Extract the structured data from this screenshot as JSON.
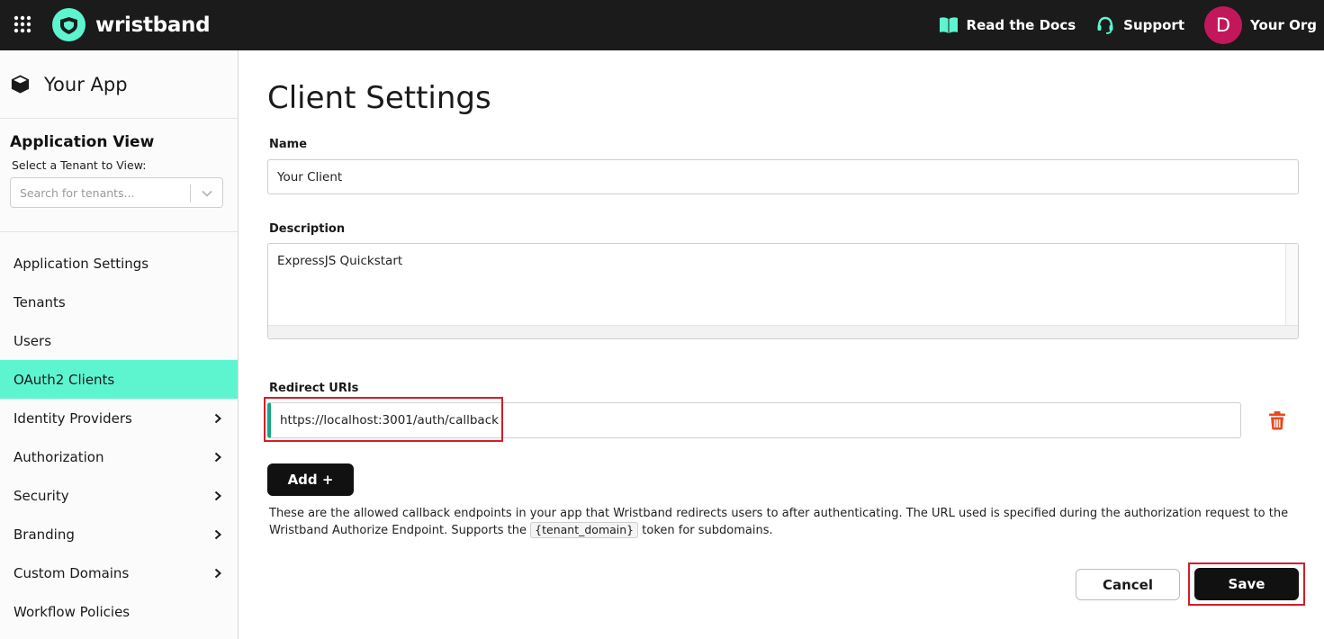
{
  "topbar": {
    "grid_icon": "apps-grid-icon",
    "brand": "wristband",
    "links": [
      {
        "label": "Read the Docs",
        "icon": "book-icon"
      },
      {
        "label": "Support",
        "icon": "headset-icon"
      }
    ],
    "avatar_initial": "D",
    "org_name": "Your Org",
    "colors": {
      "bar": "#1b1b1b",
      "accent": "#5df5d0",
      "avatar": "#c2185b"
    }
  },
  "sidebar": {
    "app_name": "Your App",
    "app_view_title": "Application View",
    "tenant_label": "Select a Tenant to View:",
    "tenant_placeholder": "Search for tenants...",
    "items": [
      {
        "label": "Application Settings",
        "has_submenu": false,
        "active": false
      },
      {
        "label": "Tenants",
        "has_submenu": false,
        "active": false
      },
      {
        "label": "Users",
        "has_submenu": false,
        "active": false
      },
      {
        "label": "OAuth2 Clients",
        "has_submenu": false,
        "active": true
      },
      {
        "label": "Identity Providers",
        "has_submenu": true,
        "active": false
      },
      {
        "label": "Authorization",
        "has_submenu": true,
        "active": false
      },
      {
        "label": "Security",
        "has_submenu": true,
        "active": false
      },
      {
        "label": "Branding",
        "has_submenu": true,
        "active": false
      },
      {
        "label": "Custom Domains",
        "has_submenu": true,
        "active": false
      },
      {
        "label": "Workflow Policies",
        "has_submenu": false,
        "active": false
      }
    ]
  },
  "main": {
    "title": "Client Settings",
    "name_label": "Name",
    "name_value": "Your Client",
    "description_label": "Description",
    "description_value": "ExpressJS Quickstart",
    "redirect_label": "Redirect URIs",
    "redirect_uris": [
      "https://localhost:3001/auth/callback"
    ],
    "add_label": "Add +",
    "help_before": "These are the allowed callback endpoints in your app that Wristband redirects users to after authenticating. The URL used is specified during the authorization request to the Wristband Authorize Endpoint. Supports the ",
    "help_token": "{tenant_domain}",
    "help_after": " token for subdomains.",
    "cancel_label": "Cancel",
    "save_label": "Save",
    "highlight_color": "#d21e2b",
    "uri_accent_color": "#1aa585",
    "delete_color": "#e8491d"
  }
}
